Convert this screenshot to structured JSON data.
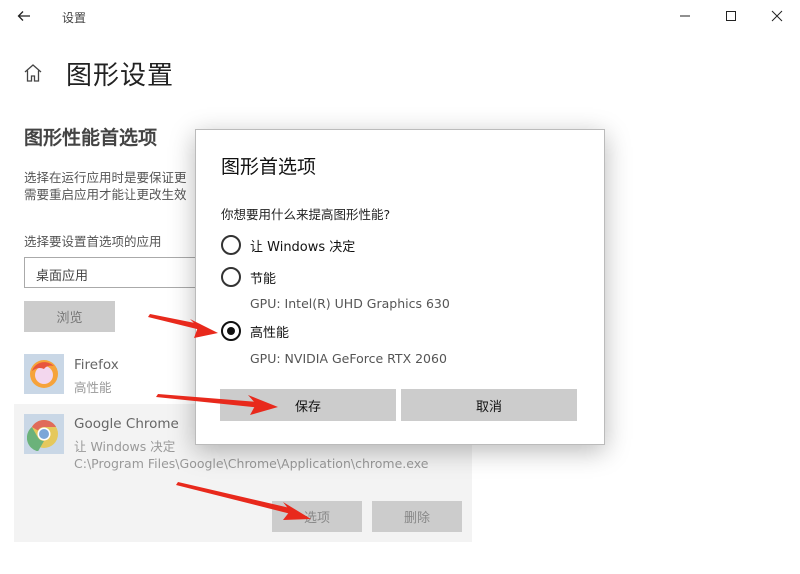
{
  "window": {
    "title": "设置",
    "back_icon": "arrow-left-icon",
    "minimize_icon": "minimize-icon",
    "maximize_icon": "maximize-icon",
    "close_icon": "close-icon"
  },
  "header": {
    "home_icon": "home-icon",
    "page_title": "图形设置"
  },
  "main": {
    "section_title": "图形性能首选项",
    "description_line1": "选择在运行应用时是要保证更",
    "description_line2": "需要重启应用才能让更改生效",
    "select_label": "选择要设置首选项的应用",
    "select_value": "桌面应用",
    "browse_label": "浏览",
    "apps": [
      {
        "name": "Firefox",
        "preference": "高性能",
        "icon": "firefox-icon"
      },
      {
        "name": "Google Chrome",
        "preference": "让 Windows 决定",
        "path": "C:\\Program Files\\Google\\Chrome\\Application\\chrome.exe",
        "options_label": "选项",
        "delete_label": "删除",
        "icon": "chrome-icon"
      }
    ]
  },
  "dialog": {
    "title": "图形首选项",
    "question": "你想要用什么来提高图形性能?",
    "options": [
      {
        "label": "让 Windows 决定",
        "checked": false
      },
      {
        "label": "节能",
        "gpu": "GPU: Intel(R) UHD Graphics 630",
        "checked": false
      },
      {
        "label": "高性能",
        "gpu": "GPU: NVIDIA GeForce RTX 2060",
        "checked": true
      }
    ],
    "save_label": "保存",
    "cancel_label": "取消"
  },
  "colors": {
    "annotation_arrow": "#e8291c",
    "button_bg": "#cccccc",
    "selected_row_bg": "#f3f3f3"
  }
}
